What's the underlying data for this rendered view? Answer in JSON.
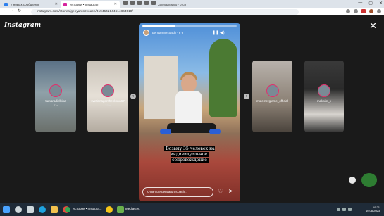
{
  "browser": {
    "tabs": [
      {
        "label": "7 новых сообщения",
        "favicon_color": "#2f80ed"
      },
      {
        "label": "Истории • Instagram",
        "favicon_color": "#d6249f"
      }
    ],
    "tab3_label": "Запись видео - отсн",
    "window_controls": [
      "—",
      "▢",
      "✕"
    ],
    "url": "instagram.com/stories/genyarunzcoach/3194542144614864518/"
  },
  "instagram": {
    "logo": "Instagram",
    "close_icon": "✕",
    "previews": [
      {
        "name": "tamaradielkina",
        "time": "7 ч"
      },
      {
        "name": "svetlanagorshenkova67",
        "time": "12 ч"
      },
      {
        "name": "molemergieme_official",
        "time": ""
      },
      {
        "name": "maksim_v",
        "time": ""
      }
    ],
    "story": {
      "user": "genyarunzcoach · 6 ч",
      "progress": 0.35,
      "caption_lines": [
        "Возьму 35 человек на индивидуальное",
        "сопровождение"
      ],
      "reply_placeholder": "Ответьте genyarunzcoach...",
      "pause_icon": "❚❚",
      "mute_icon": "◀)",
      "more_icon": "···"
    }
  },
  "taskbar": {
    "items": [
      {
        "label": "",
        "icon": "windows-start-icon",
        "color": "#4aa3ff"
      },
      {
        "label": "",
        "icon": "search-icon",
        "color": "#cfd8dc"
      },
      {
        "label": "",
        "icon": "task-view-icon",
        "color": "#cfd8dc"
      },
      {
        "label": "",
        "icon": "edge-icon",
        "color": "#1fa3e0"
      },
      {
        "label": "",
        "icon": "file-explorer-icon",
        "color": "#f2c14e"
      },
      {
        "label": "",
        "icon": "store-icon",
        "color": "#3a7bd5"
      },
      {
        "label": "",
        "icon": "mail-icon",
        "color": "#2f80ed"
      },
      {
        "label": "",
        "icon": "chrome-icon",
        "color": "#e74c3c"
      },
      {
        "label": "История • Instagra...",
        "icon": "chrome-window-icon",
        "color": "#34a853"
      },
      {
        "label": "",
        "icon": "media-icon",
        "color": "#f5c518"
      },
      {
        "label": "MediaGet",
        "icon": "mediaget-icon",
        "color": "#6ab04c"
      }
    ],
    "time": "19:21",
    "date": "10.08.2023"
  }
}
